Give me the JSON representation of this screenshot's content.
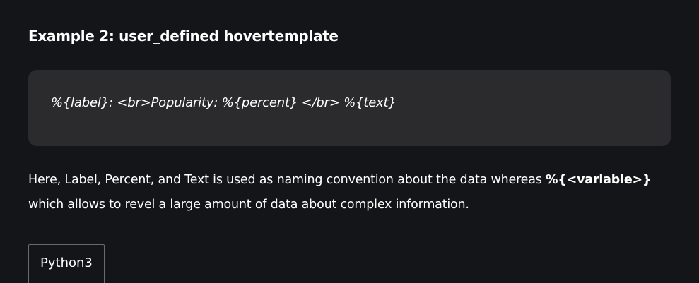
{
  "heading": "Example 2: user_defined hovertemplate",
  "code_block": {
    "text": "%{label}: <br>Popularity: %{percent} </br> %{text}"
  },
  "paragraph": {
    "before_bold": "Here, Label, Percent, and Text is used as naming convention about the data whereas ",
    "bold": "%{<variable>}",
    "after_bold": " which allows to revel a large amount of data about complex information."
  },
  "tabs": [
    {
      "label": "Python3"
    }
  ]
}
